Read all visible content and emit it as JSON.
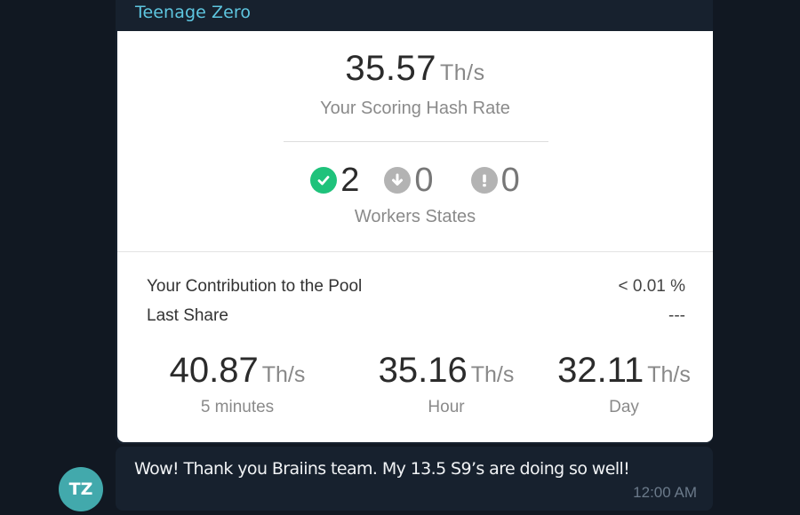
{
  "forwarded": {
    "author": "Teenage Zero",
    "author_color": "#5ec6e0"
  },
  "card": {
    "scoring_hash_rate": {
      "value": "35.57",
      "unit": "Th/s",
      "label": "Your Scoring Hash Rate"
    },
    "workers": {
      "label": "Workers States",
      "states": [
        {
          "icon": "check-circle-icon",
          "count": "2",
          "color": "#1fc27b"
        },
        {
          "icon": "arrow-down-circle-icon",
          "count": "0",
          "color": "#b3b3b3"
        },
        {
          "icon": "exclamation-circle-icon",
          "count": "0",
          "color": "#b3b3b3"
        }
      ]
    },
    "contribution": {
      "label": "Your Contribution to the Pool",
      "value": "< 0.01 %"
    },
    "last_share": {
      "label": "Last Share",
      "value": "---"
    },
    "hash_rates": [
      {
        "value": "40.87",
        "unit": "Th/s",
        "label": "5 minutes"
      },
      {
        "value": "35.16",
        "unit": "Th/s",
        "label": "Hour"
      },
      {
        "value": "32.11",
        "unit": "Th/s",
        "label": "Day"
      }
    ]
  },
  "message": {
    "avatar_initials": "TZ",
    "avatar_color": "#42a9ac",
    "text": "Wow! Thank you Braiins team. My 13.5 S9’s are doing so well!",
    "time": "12:00 AM"
  }
}
